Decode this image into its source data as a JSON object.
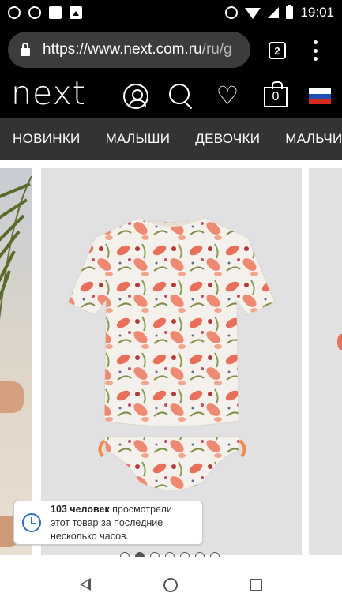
{
  "status_bar": {
    "time": "19:01",
    "icons": [
      "keyhole-icon",
      "lock-person-icon",
      "square-icon",
      "image-icon",
      "alarm-icon",
      "wifi-icon",
      "signal-icon",
      "battery-icon"
    ]
  },
  "browser": {
    "url_main": "https://www.next.com.ru",
    "url_rest": "/ru/g",
    "tab_count": "2"
  },
  "header": {
    "logo": "next",
    "bag_count": "0",
    "flag_colors": [
      "#ffffff",
      "#1f4fb3",
      "#d52b1e"
    ]
  },
  "nav": {
    "items": [
      "НОВИНКИ",
      "МАЛЫШИ",
      "ДЕВОЧКИ",
      "МАЛЬЧИКИ"
    ]
  },
  "notice": {
    "count": "103 человек",
    "text_line1": " просмотрели",
    "text_line2": "этот товар за последние",
    "text_line3": "несколько часов."
  },
  "carousel": {
    "total": 7,
    "active_index": 1
  },
  "colors": {
    "accent": "#2a6fc1",
    "nav_bg": "#333333",
    "image_bg": "#e1e1e3"
  }
}
